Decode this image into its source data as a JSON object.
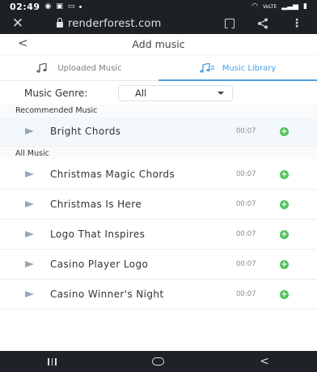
{
  "status_bar": {
    "time": "02:49",
    "right_text": "VoLTE"
  },
  "browser": {
    "url": "renderforest.com"
  },
  "header": {
    "back_glyph": "<",
    "title": "Add music"
  },
  "tabs": [
    {
      "label": "Uploaded Music",
      "active": false,
      "icon": "music-note-icon"
    },
    {
      "label": "Music Library",
      "active": true,
      "icon": "music-library-icon"
    }
  ],
  "colors": {
    "accent": "#4a9fe4",
    "add": "#52c25c",
    "play": "#9aa8b6"
  },
  "genre": {
    "label": "Music Genre:",
    "selected": "All"
  },
  "recommended": {
    "title": "Recommended Music",
    "tracks": [
      {
        "name": "Bright Chords",
        "duration": "00:07"
      }
    ]
  },
  "all_music": {
    "title": "All Music",
    "tracks": [
      {
        "name": "Christmas Magic Chords",
        "duration": "00:07"
      },
      {
        "name": "Christmas Is Here",
        "duration": "00:07"
      },
      {
        "name": "Logo That Inspires",
        "duration": "00:07"
      },
      {
        "name": "Casino Player Logo",
        "duration": "00:07"
      },
      {
        "name": "Casino Winner's Night",
        "duration": "00:07"
      }
    ]
  },
  "add_glyph": "+"
}
